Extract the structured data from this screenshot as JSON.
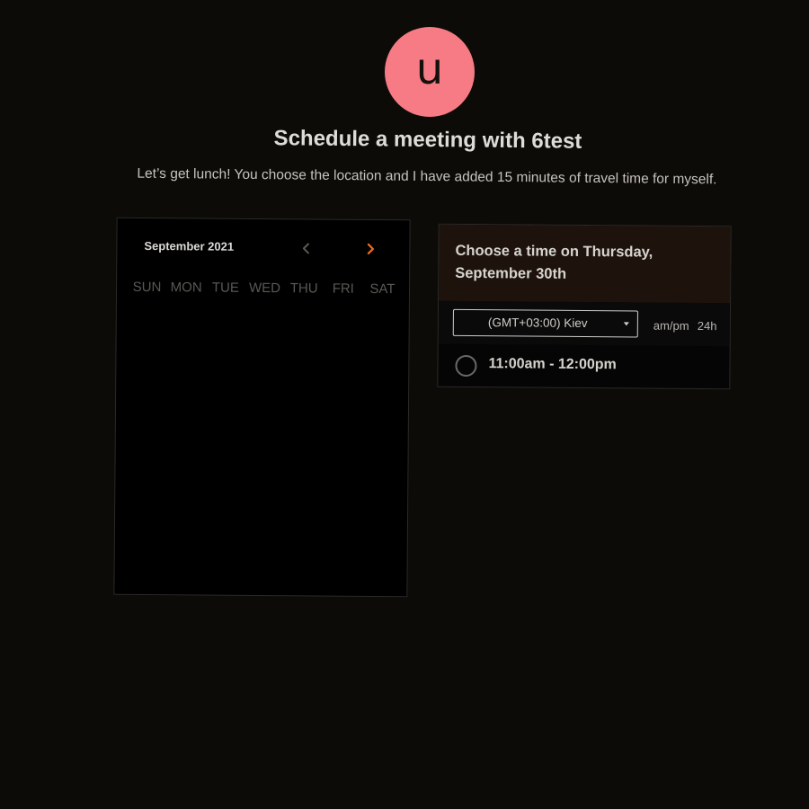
{
  "host": {
    "avatar_initial": "u",
    "avatar_color": "#f77b84"
  },
  "page": {
    "title": "Schedule a meeting with 6test",
    "description": "Let’s get lunch! You choose the location and I have added 15 minutes of travel time for myself."
  },
  "calendar": {
    "month_label": "September 2021",
    "prev_icon": "chevron-left-icon",
    "next_icon": "chevron-right-icon",
    "accent_color": "#f06a23",
    "weekdays": [
      "SUN",
      "MON",
      "TUE",
      "WED",
      "THU",
      "FRI",
      "SAT"
    ]
  },
  "time_picker": {
    "heading": "Choose a time on Thursday, September 30th",
    "timezone": {
      "selected": "(GMT+03:00) Kiev",
      "icon": "caret-down-icon"
    },
    "format_options": [
      "am/pm",
      "24h"
    ],
    "slots": [
      {
        "label": "11:00am - 12:00pm"
      }
    ]
  }
}
